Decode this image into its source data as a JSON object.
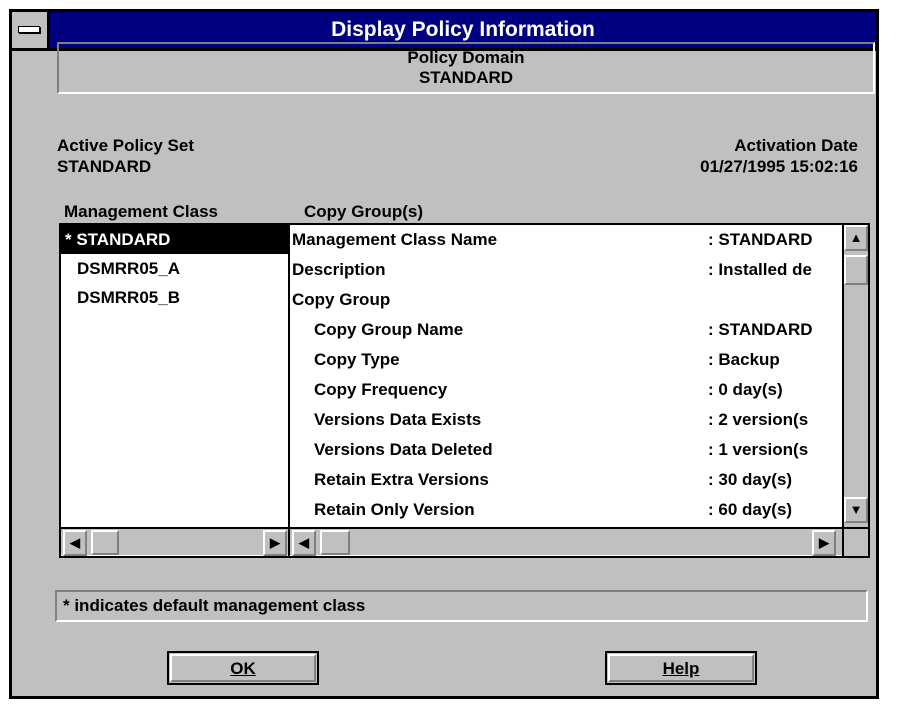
{
  "window": {
    "title": "Display Policy Information"
  },
  "policy_domain": {
    "label": "Policy Domain",
    "value": "STANDARD"
  },
  "active_policy_set": {
    "label": "Active Policy Set",
    "value": "STANDARD"
  },
  "activation_date": {
    "label": "Activation Date",
    "value": "01/27/1995 15:02:16"
  },
  "management_class": {
    "header": "Management Class",
    "items": [
      {
        "label": "* STANDARD",
        "selected": true
      },
      {
        "label": "DSMRR05_A",
        "selected": false
      },
      {
        "label": "DSMRR05_B",
        "selected": false
      }
    ]
  },
  "copy_groups": {
    "header": "Copy Group(s)",
    "rows": [
      {
        "key": "Management Class Name",
        "value": ": STANDARD",
        "indent": false
      },
      {
        "key": "Description",
        "value": ": Installed de",
        "indent": false
      },
      {
        "key": "Copy Group",
        "value": "",
        "indent": false
      },
      {
        "key": "Copy Group Name",
        "value": ": STANDARD",
        "indent": true
      },
      {
        "key": "Copy Type",
        "value": ": Backup",
        "indent": true
      },
      {
        "key": "Copy Frequency",
        "value": ": 0 day(s)",
        "indent": true
      },
      {
        "key": "Versions Data Exists",
        "value": ": 2 version(s",
        "indent": true
      },
      {
        "key": "Versions Data Deleted",
        "value": ": 1 version(s",
        "indent": true
      },
      {
        "key": "Retain Extra Versions",
        "value": ": 30 day(s)",
        "indent": true
      },
      {
        "key": "Retain Only Version",
        "value": ": 60 day(s)",
        "indent": true
      }
    ]
  },
  "status": {
    "text": "* indicates default management class"
  },
  "buttons": {
    "ok": "OK",
    "help": "Help"
  },
  "icons": {
    "scroll_up": "up-arrow-icon",
    "scroll_down": "down-arrow-icon",
    "scroll_left": "left-arrow-icon",
    "scroll_right": "right-arrow-icon",
    "system_menu": "system-menu-icon"
  }
}
